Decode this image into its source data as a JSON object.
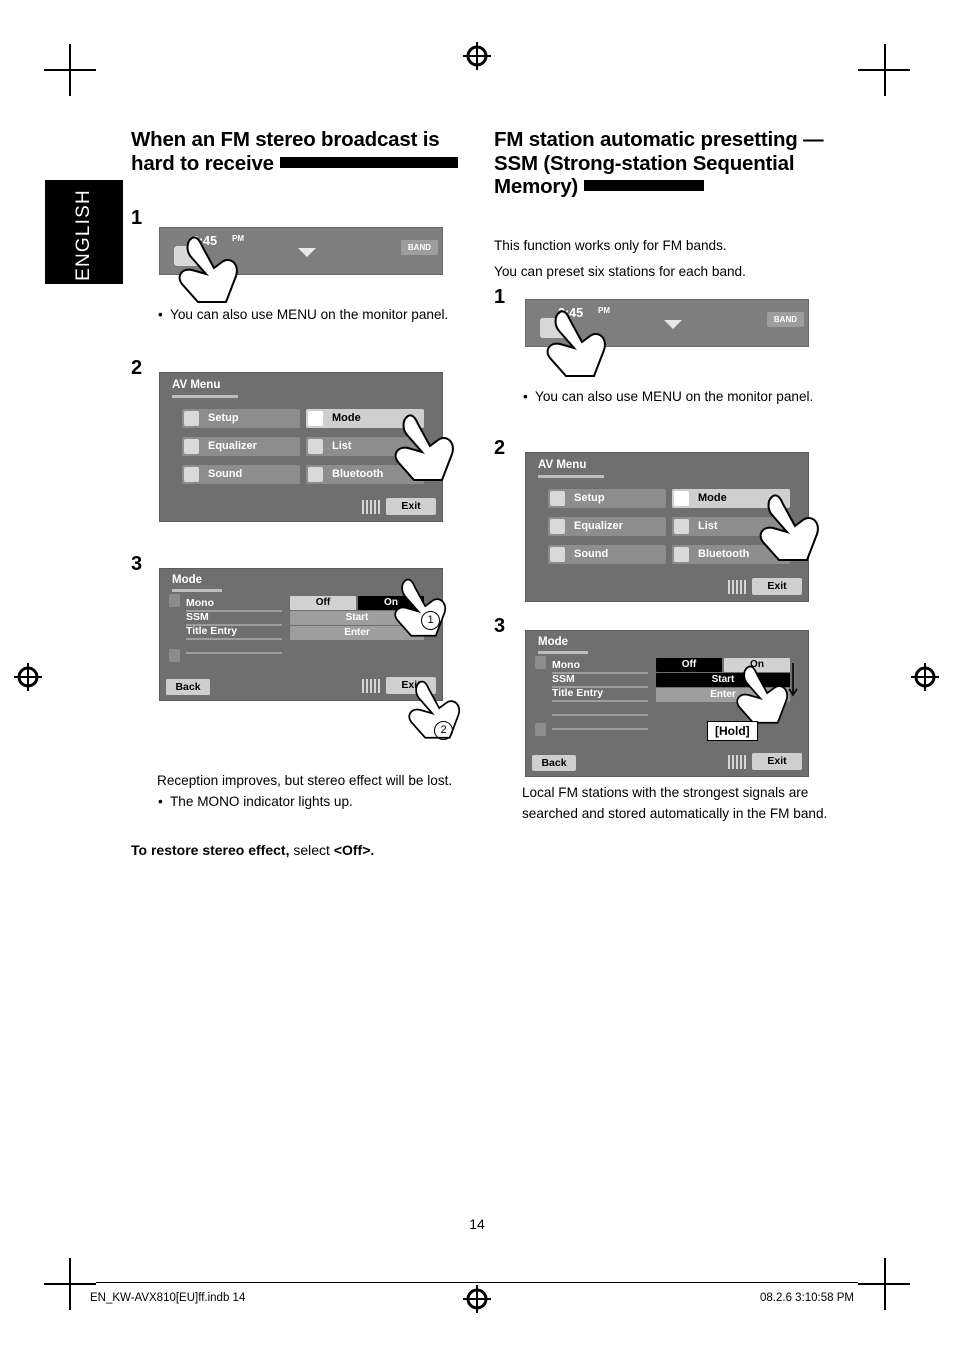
{
  "language_tab": "ENGLISH",
  "page_number": "14",
  "footer": {
    "left": "EN_KW-AVX810[EU]ff.indb   14",
    "right": "08.2.6   3:10:58 PM"
  },
  "left_column": {
    "heading": "When an FM stereo broadcast is hard to receive",
    "steps": [
      "1",
      "2",
      "3"
    ],
    "note_menu": "You can also use MENU on the monitor panel.",
    "result_line": "Reception improves, but stereo effect will be lost.",
    "result_bullet": "The MONO indicator lights up.",
    "restore_bold": "To restore stereo effect,",
    "restore_rest": " select ",
    "restore_value": "<Off>.",
    "device_bar": {
      "clock": "3:45",
      "meridiem": "PM",
      "band_label": "BAND"
    },
    "av_menu": {
      "title": "AV Menu",
      "items": [
        {
          "label": "Setup",
          "icon": "gear-icon",
          "highlight": false
        },
        {
          "label": "Mode",
          "icon": "mode-icon",
          "highlight": true
        },
        {
          "label": "Equalizer",
          "icon": "equalizer-icon",
          "highlight": false
        },
        {
          "label": "List",
          "icon": "list-icon",
          "highlight": false
        },
        {
          "label": "Sound",
          "icon": "sound-icon",
          "highlight": false
        },
        {
          "label": "Bluetooth",
          "icon": "bluetooth-icon",
          "highlight": false
        }
      ],
      "exit": "Exit"
    },
    "mode_panel": {
      "title": "Mode",
      "rows": [
        {
          "label": "Mono",
          "left": "Off",
          "right": "On"
        },
        {
          "label": "SSM",
          "center": "Start"
        },
        {
          "label": "Title Entry",
          "center": "Enter"
        }
      ],
      "back": "Back",
      "exit": "Exit",
      "callout_1": "1",
      "callout_2": "2"
    }
  },
  "right_column": {
    "heading": "FM station automatic presetting —SSM (Strong-station Sequential Memory)",
    "intro_1": "This function works only for FM bands.",
    "intro_2": "You can preset six stations for each band.",
    "steps": [
      "1",
      "2",
      "3"
    ],
    "note_menu": "You can also use MENU on the monitor panel.",
    "result_1": "Local FM stations with the strongest signals are",
    "result_2": "searched and stored automatically in the FM band.",
    "device_bar": {
      "clock": "3:45",
      "meridiem": "PM",
      "band_label": "BAND"
    },
    "av_menu": {
      "title": "AV Menu",
      "items": [
        {
          "label": "Setup",
          "icon": "gear-icon",
          "highlight": false
        },
        {
          "label": "Mode",
          "icon": "mode-icon",
          "highlight": true
        },
        {
          "label": "Equalizer",
          "icon": "equalizer-icon",
          "highlight": false
        },
        {
          "label": "List",
          "icon": "list-icon",
          "highlight": false
        },
        {
          "label": "Sound",
          "icon": "sound-icon",
          "highlight": false
        },
        {
          "label": "Bluetooth",
          "icon": "bluetooth-icon",
          "highlight": false
        }
      ],
      "exit": "Exit"
    },
    "mode_panel": {
      "title": "Mode",
      "rows": [
        {
          "label": "Mono",
          "left": "Off",
          "right": "On"
        },
        {
          "label": "SSM",
          "center": "Start"
        },
        {
          "label": "Title Entry",
          "center": "Enter"
        }
      ],
      "hold": "[Hold]",
      "back": "Back",
      "exit": "Exit"
    }
  }
}
